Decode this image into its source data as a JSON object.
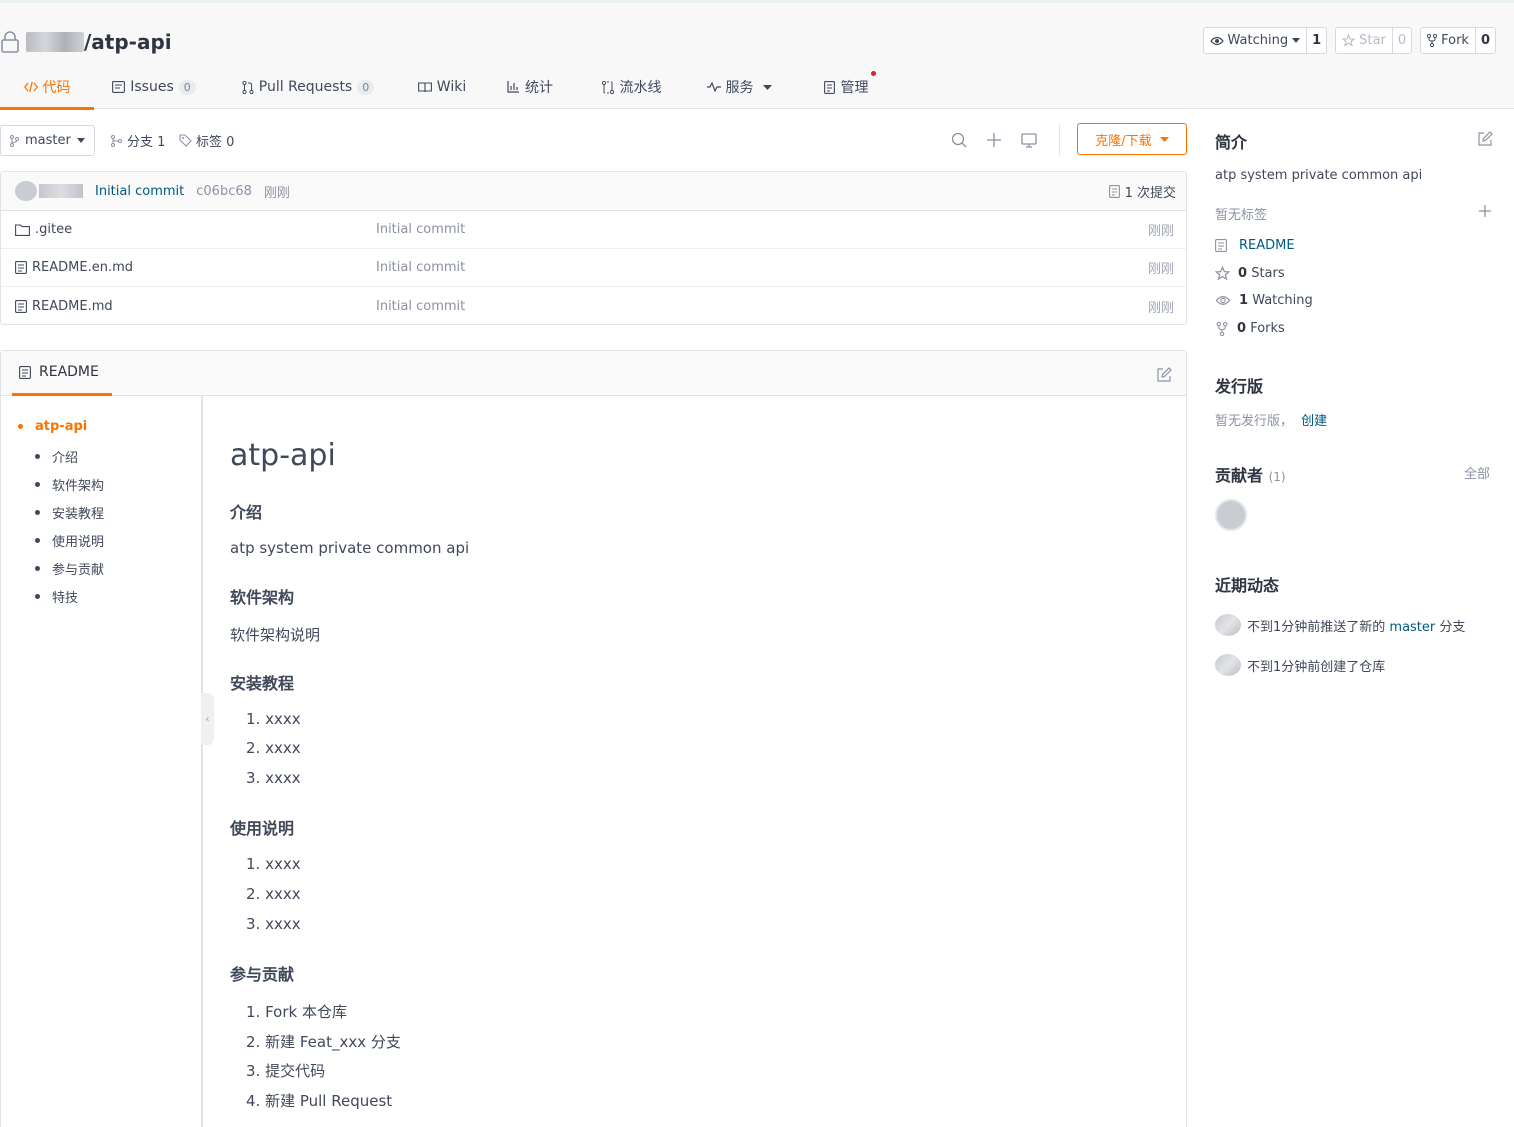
{
  "repo": {
    "name": "/atp-api"
  },
  "header_buttons": {
    "watch": {
      "label": "Watching",
      "count": "1"
    },
    "star": {
      "label": "Star",
      "count": "0"
    },
    "fork": {
      "label": "Fork",
      "count": "0"
    }
  },
  "tabs": [
    {
      "label": "代码"
    },
    {
      "label": "Issues",
      "count": "0"
    },
    {
      "label": "Pull Requests",
      "count": "0"
    },
    {
      "label": "Wiki"
    },
    {
      "label": "统计"
    },
    {
      "label": "流水线"
    },
    {
      "label": "服务"
    },
    {
      "label": "管理"
    }
  ],
  "toolbar": {
    "branch": "master",
    "branches": "分支 1",
    "tags": "标签 0",
    "clone_label": "克隆/下载"
  },
  "last_commit": {
    "message": "Initial commit",
    "hash": "c06bc68",
    "time": "刚刚",
    "count": "1 次提交"
  },
  "files": [
    {
      "name": ".gitee",
      "type": "folder",
      "message": "Initial commit",
      "time": "刚刚"
    },
    {
      "name": "README.en.md",
      "type": "file",
      "message": "Initial commit",
      "time": "刚刚"
    },
    {
      "name": "README.md",
      "type": "file",
      "message": "Initial commit",
      "time": "刚刚"
    }
  ],
  "readme": {
    "tab_label": "README",
    "toc": [
      "atp-api",
      "介绍",
      "软件架构",
      "安装教程",
      "使用说明",
      "参与贡献",
      "特技"
    ],
    "title": "atp-api",
    "sections": {
      "intro_h": "介绍",
      "intro_p": "atp system private common api",
      "arch_h": "软件架构",
      "arch_p": "软件架构说明",
      "install_h": "安装教程",
      "install_items": [
        "1. xxxx",
        "2. xxxx",
        "3. xxxx"
      ],
      "usage_h": "使用说明",
      "usage_items": [
        "1. xxxx",
        "2. xxxx",
        "3. xxxx"
      ],
      "contrib_h": "参与贡献",
      "contrib_items": [
        "1. Fork 本仓库",
        "2. 新建 Feat_xxx 分支",
        "3. 提交代码",
        "4. 新建 Pull Request"
      ]
    }
  },
  "sidebar": {
    "intro_title": "简介",
    "description": "atp system private common api",
    "no_tags": "暂无标签",
    "readme_link": "README",
    "stars": {
      "count": "0",
      "label": "Stars"
    },
    "watching": {
      "count": "1",
      "label": "Watching"
    },
    "forks": {
      "count": "0",
      "label": "Forks"
    },
    "releases_title": "发行版",
    "no_releases": "暂无发行版，",
    "create_link": "创建",
    "contributors_title": "贡献者",
    "contributors_count": "(1)",
    "all_link": "全部",
    "activity_title": "近期动态",
    "activities": [
      {
        "prefix": "不到1分钟前推送了新的 ",
        "branch": "master",
        "suffix": " 分支"
      },
      {
        "text": "不到1分钟前创建了仓库"
      }
    ]
  },
  "colors": {
    "accent": "#fe7300",
    "link": "#005980"
  }
}
